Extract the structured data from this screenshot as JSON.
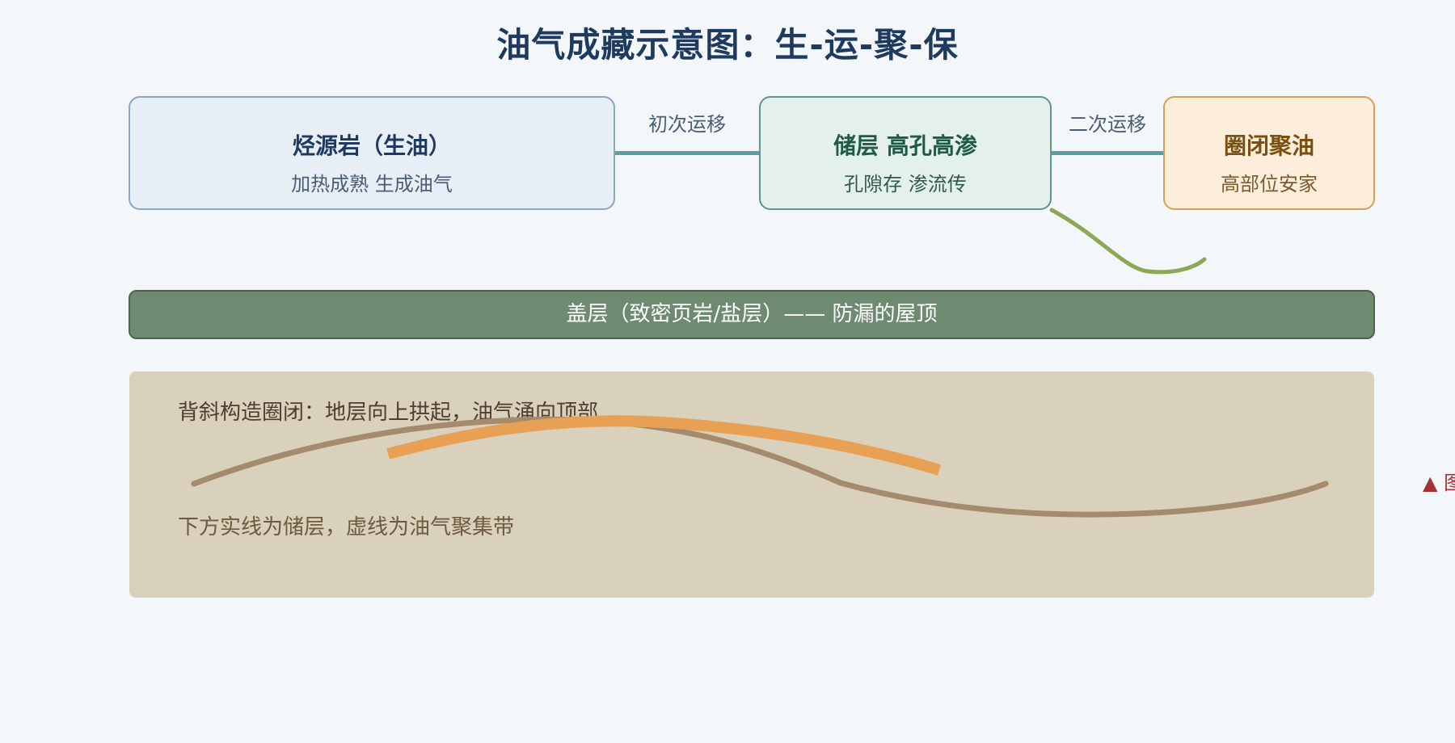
{
  "title": "油气成藏示意图：生-运-聚-保",
  "boxes": {
    "source": {
      "title": "烃源岩（生油）",
      "subtitle": "加热成熟 生成油气"
    },
    "reservoir": {
      "title": "储层 高孔高渗",
      "subtitle": "孔隙存 渗流传"
    },
    "trap": {
      "title": "圈闭聚油",
      "subtitle": "高部位安家"
    }
  },
  "migration": {
    "primary": "初次运移",
    "secondary": "二次运移"
  },
  "cap_rock": "盖层（致密页岩/盐层）—— 防漏的屋顶",
  "anticline": {
    "caption": "背斜构造圈闭：地层向上拱起，油气涌向顶部",
    "note": "下方实线为储层，虚线为油气聚集带"
  },
  "edge_marker": "▲ 图",
  "colors": {
    "background": "#f3f7fa",
    "title": "#1e3a5f",
    "connector": "#5f9ea0",
    "cap_rock": "#6e8b72",
    "panel": "#d9d1bc",
    "reservoir_curve": "#a58a6e",
    "oil_curve": "#e8a055",
    "leak_curve": "#8aa856"
  }
}
